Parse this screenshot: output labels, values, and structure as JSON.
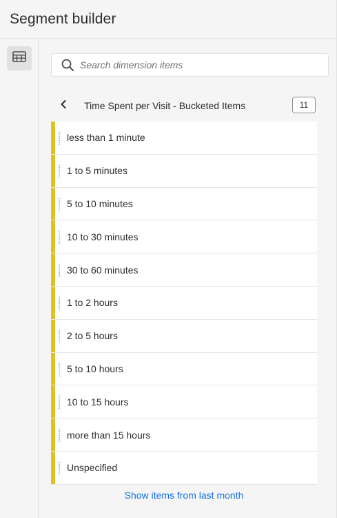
{
  "header": {
    "title": "Segment builder"
  },
  "rail": {
    "panel_icon": "dimensions-panel-icon"
  },
  "search": {
    "placeholder": "Search dimension items",
    "value": "",
    "icon": "search-icon"
  },
  "list": {
    "back_icon": "chevron-left-icon",
    "title": "Time Spent per Visit - Bucketed Items",
    "count": "11",
    "accent_color": "#e2c220",
    "items": [
      {
        "label": "less than 1 minute"
      },
      {
        "label": "1 to 5 minutes"
      },
      {
        "label": "5 to 10 minutes"
      },
      {
        "label": "10 to 30 minutes"
      },
      {
        "label": "30 to 60 minutes"
      },
      {
        "label": "1 to 2 hours"
      },
      {
        "label": "2 to 5 hours"
      },
      {
        "label": "5 to 10 hours"
      },
      {
        "label": "10 to 15 hours"
      },
      {
        "label": "more than 15 hours"
      },
      {
        "label": "Unspecified"
      }
    ]
  },
  "footer": {
    "show_more_label": "Show items from last month",
    "link_color": "#1473e6"
  }
}
